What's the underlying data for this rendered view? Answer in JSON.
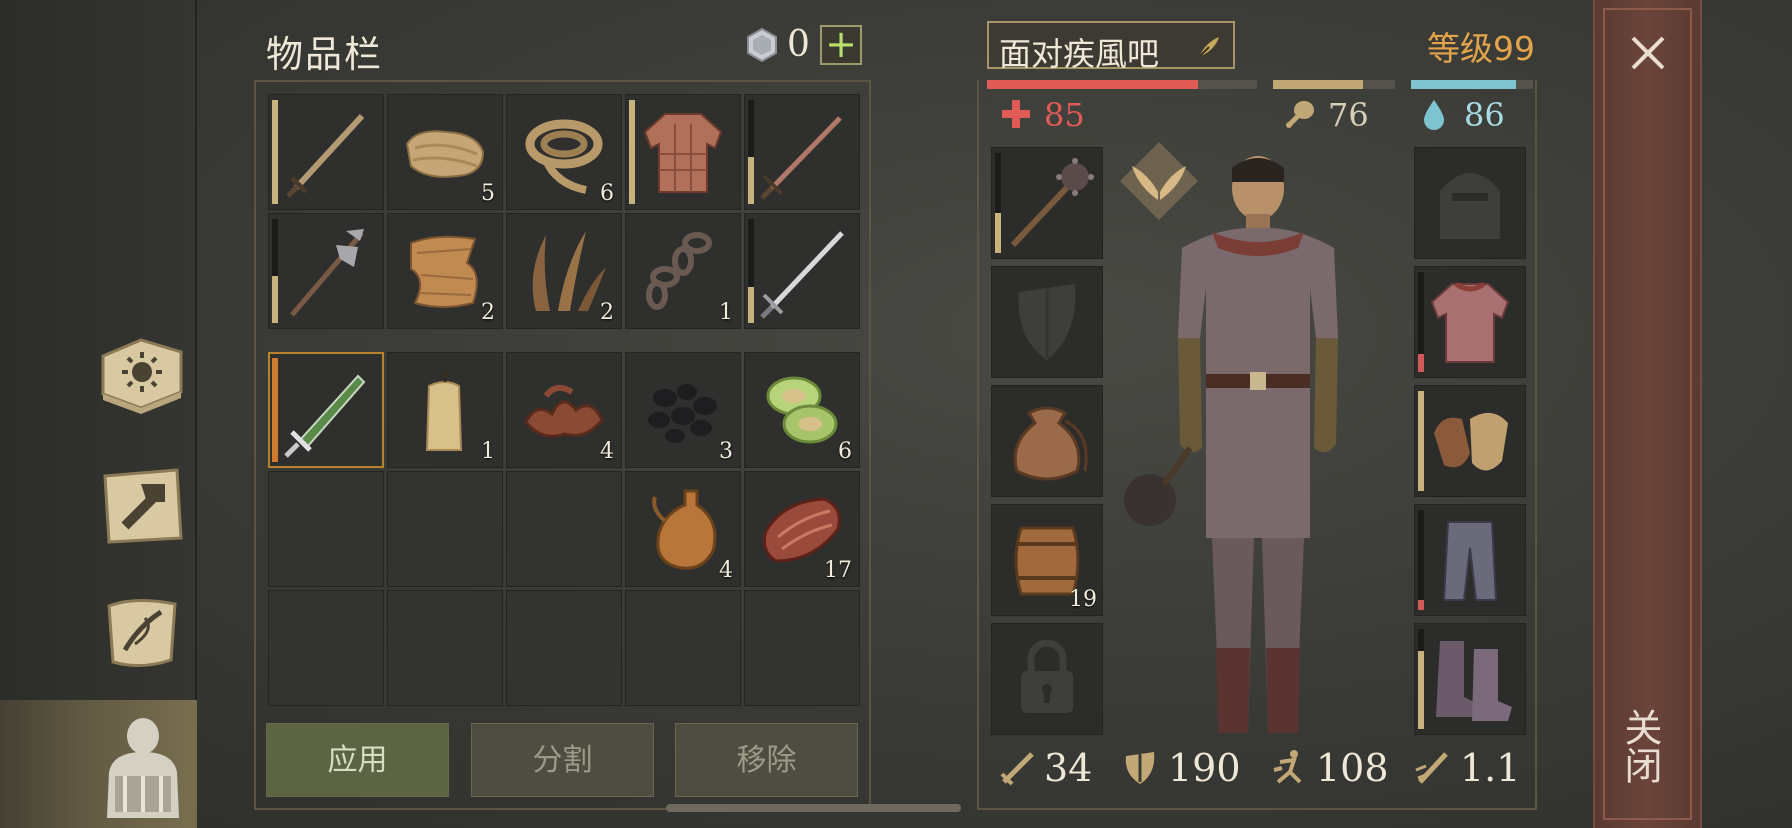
{
  "inventory": {
    "title": "物品栏",
    "coins": "0",
    "add_label": "+",
    "slots": [
      {
        "icon": "sword-icon",
        "count": ""
      },
      {
        "icon": "cloth-roll-icon",
        "count": "5"
      },
      {
        "icon": "rope-icon",
        "count": "6"
      },
      {
        "icon": "padded-armor-icon",
        "count": ""
      },
      {
        "icon": "sword-icon",
        "count": ""
      },
      {
        "icon": "halberd-icon",
        "count": ""
      },
      {
        "icon": "leather-scrap-icon",
        "count": "2"
      },
      {
        "icon": "plant-fiber-icon",
        "count": "2"
      },
      {
        "icon": "chain-icon",
        "count": "1"
      },
      {
        "icon": "steel-sword-icon",
        "count": ""
      },
      {
        "icon": "poison-dagger-icon",
        "count": ""
      },
      {
        "icon": "candle-icon",
        "count": "1"
      },
      {
        "icon": "guts-icon",
        "count": "4"
      },
      {
        "icon": "coal-icon",
        "count": "3"
      },
      {
        "icon": "bandage-icon",
        "count": "6"
      },
      {
        "icon": "",
        "count": ""
      },
      {
        "icon": "",
        "count": ""
      },
      {
        "icon": "",
        "count": ""
      },
      {
        "icon": "waterskin-icon",
        "count": "4"
      },
      {
        "icon": "raw-meat-icon",
        "count": "17"
      }
    ],
    "buttons": {
      "apply": "应用",
      "split": "分割",
      "remove": "移除"
    }
  },
  "character": {
    "name": "面对疾風吧",
    "level": "等级99",
    "health": "85",
    "food": "76",
    "water": "86",
    "health_fill": 0.78,
    "food_fill": 0.74,
    "water_fill": 0.86,
    "equipment_left": [
      {
        "slot": "weapon",
        "icon": "mace-icon",
        "count": ""
      },
      {
        "slot": "shield",
        "icon": "shield-icon",
        "count": ""
      },
      {
        "slot": "bag",
        "icon": "bag-icon",
        "count": ""
      },
      {
        "slot": "container",
        "icon": "barrel-icon",
        "count": "19"
      },
      {
        "slot": "locked",
        "icon": "lock-icon",
        "count": ""
      }
    ],
    "equipment_right": [
      {
        "slot": "head",
        "icon": "helmet-icon",
        "count": ""
      },
      {
        "slot": "torso",
        "icon": "chainmail-icon",
        "count": ""
      },
      {
        "slot": "hands",
        "icon": "gloves-icon",
        "count": ""
      },
      {
        "slot": "legs",
        "icon": "pants-icon",
        "count": ""
      },
      {
        "slot": "feet",
        "icon": "boots-icon",
        "count": ""
      }
    ],
    "stats": {
      "attack": "34",
      "armor": "190",
      "speed": "108",
      "attack_speed": "1.1"
    }
  },
  "close_label": "关闭",
  "colors": {
    "health": "#e05a56",
    "food": "#c2a877",
    "water": "#7ec4d0",
    "level": "#e2a54c",
    "accent": "#b6e06a"
  }
}
